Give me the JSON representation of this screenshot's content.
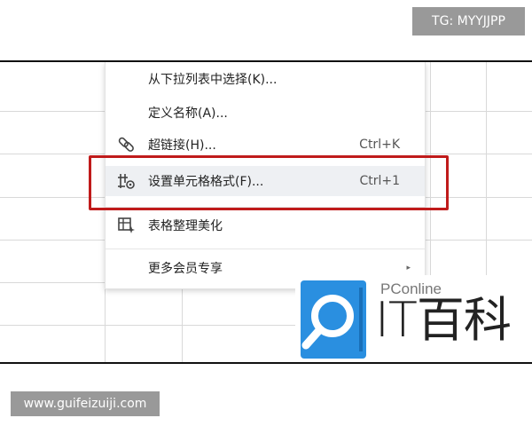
{
  "overlay": {
    "tg_badge": "TG: MYYJJPP",
    "website": "www.guifeizuiji.com"
  },
  "menu": {
    "items": [
      {
        "label": "从下拉列表中选择(K)...",
        "shortcut": "",
        "icon": ""
      },
      {
        "label": "定义名称(A)...",
        "shortcut": "",
        "icon": ""
      },
      {
        "label": "超链接(H)...",
        "shortcut": "Ctrl+K",
        "icon": "link-icon"
      },
      {
        "label": "设置单元格格式(F)...",
        "shortcut": "Ctrl+1",
        "icon": "cell-format-icon"
      },
      {
        "label": "表格整理美化",
        "shortcut": "",
        "icon": "table-beautify-icon"
      },
      {
        "label": "更多会员专享",
        "shortcut": "",
        "icon": "",
        "submenu_arrow": "▸"
      }
    ]
  },
  "logo": {
    "brand": "PConline",
    "title": "IT百科"
  },
  "colors": {
    "highlight_box": "#c01b1b",
    "logo_blue": "#2a8fe0",
    "badge_gray": "#999999"
  }
}
